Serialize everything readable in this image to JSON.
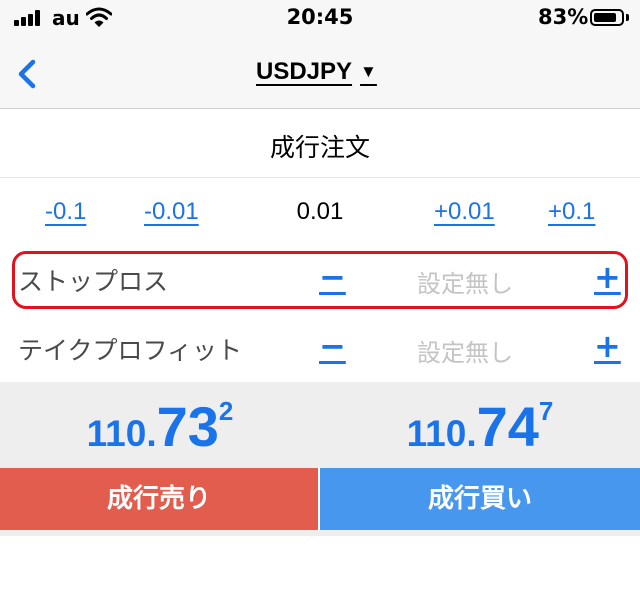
{
  "status_bar": {
    "carrier": "au",
    "time": "20:45",
    "battery_percent": "83%",
    "battery_level": 0.83,
    "signal_icon": "signal-bars-icon",
    "wifi_icon": "wifi-icon",
    "battery_icon": "battery-icon"
  },
  "nav": {
    "back_icon": "chevron-left-icon",
    "symbol": "USDJPY",
    "dropdown_arrow": "▼"
  },
  "order": {
    "type_label": "成行注文"
  },
  "volume": {
    "dec_large": "-0.1",
    "dec_small": "-0.01",
    "value": "0.01",
    "inc_small": "+0.01",
    "inc_large": "+0.1"
  },
  "stop_loss": {
    "label": "ストップロス",
    "minus": "−",
    "value": "設定無し",
    "plus": "+"
  },
  "take_profit": {
    "label": "テイクプロフィット",
    "minus": "−",
    "value": "設定無し",
    "plus": "+"
  },
  "quotes": {
    "bid": {
      "prefix": "110.",
      "big": "73",
      "sup": "2"
    },
    "ask": {
      "prefix": "110.",
      "big": "74",
      "sup": "7"
    }
  },
  "buttons": {
    "sell_label": "成行売り",
    "buy_label": "成行買い"
  },
  "colors": {
    "accent_blue": "#1a73e8",
    "sell_red": "#e35d4f",
    "buy_blue": "#4797ee",
    "highlight_red": "#e0131d"
  }
}
